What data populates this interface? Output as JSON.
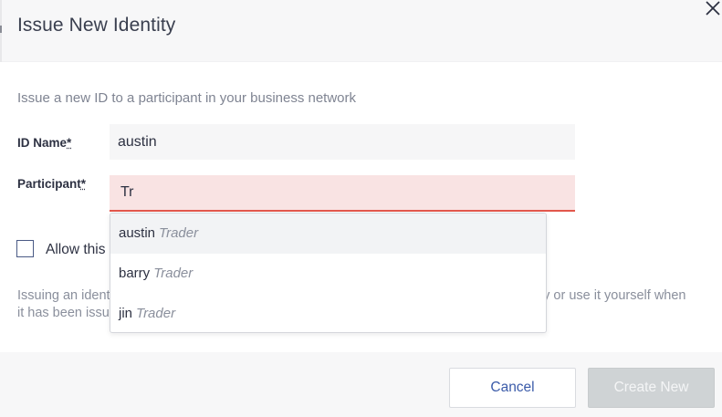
{
  "dialog": {
    "title": "Issue New Identity",
    "description": "Issue a new ID to a participant in your business network"
  },
  "form": {
    "id_name": {
      "label": "ID Name",
      "required_mark": "*",
      "value": "austin"
    },
    "participant": {
      "label": "Participant",
      "required_mark": "*",
      "value": "Tr"
    },
    "allow_checkbox": {
      "label": "Allow this",
      "checked": false
    },
    "note": {
      "left_part": "Issuing an ident",
      "right_part": "ody or use it yourself when",
      "line2": "it has been issu"
    }
  },
  "dropdown": {
    "items": [
      {
        "name": "austin",
        "type": "Trader"
      },
      {
        "name": "barry",
        "type": "Trader"
      },
      {
        "name": "jin",
        "type": "Trader"
      }
    ]
  },
  "footer": {
    "cancel_label": "Cancel",
    "create_label": "Create New"
  },
  "colors": {
    "accent": "#3b5ba9",
    "error_border": "#e2574c",
    "error_bg": "#f9e3e3",
    "disabled_button": "#cfd3d5"
  },
  "icons": {
    "close": "close-icon"
  }
}
